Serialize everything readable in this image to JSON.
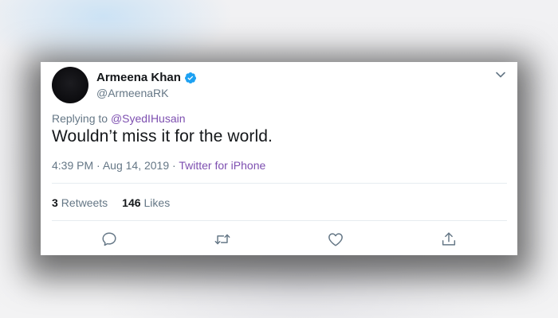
{
  "tweet": {
    "author": {
      "display_name": "Armeena Khan",
      "handle": "@ArmeenaRK",
      "verified": true
    },
    "reply_prefix": "Replying to",
    "reply_to": "@SyedIHusain",
    "text": "Wouldn’t miss it for the world.",
    "time": "4:39 PM",
    "date": "Aug 14, 2019",
    "separator": "·",
    "source": "Twitter for iPhone",
    "stats": {
      "retweets_count": "3",
      "retweets_label": "Retweets",
      "likes_count": "146",
      "likes_label": "Likes"
    },
    "actions": [
      "reply-icon",
      "retweet-icon",
      "like-icon",
      "share-icon"
    ]
  },
  "colors": {
    "text_primary": "#14171a",
    "text_secondary": "#657786",
    "link_accent": "#7d4fb0",
    "verified_badge": "#1da1f2",
    "divider": "#e6ecf0"
  }
}
